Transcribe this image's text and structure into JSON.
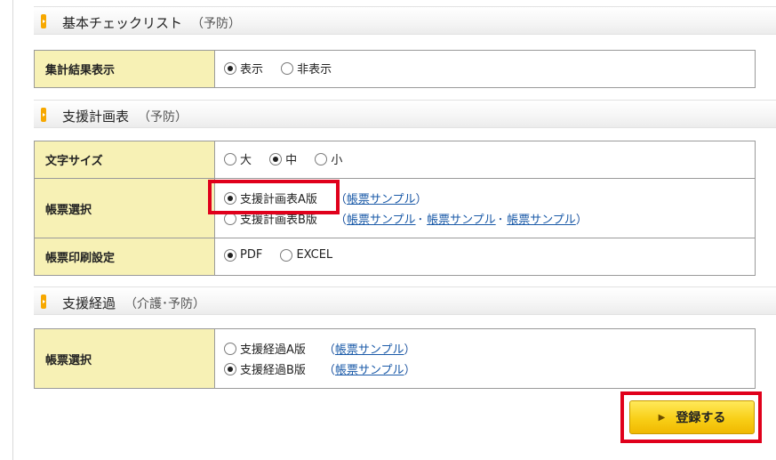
{
  "sections": [
    {
      "title": "基本チェックリスト",
      "sub": "（予防）"
    },
    {
      "title": "支援計画表",
      "sub": "（予防）"
    },
    {
      "title": "支援経過",
      "sub": "（介護･予防）"
    }
  ],
  "checklist": {
    "row_label": "集計結果表示",
    "options": [
      {
        "label": "表示",
        "selected": true
      },
      {
        "label": "非表示",
        "selected": false
      }
    ]
  },
  "plan": {
    "font_size": {
      "label": "文字サイズ",
      "options": [
        {
          "label": "大",
          "selected": false
        },
        {
          "label": "中",
          "selected": true
        },
        {
          "label": "小",
          "selected": false
        }
      ]
    },
    "form_select": {
      "label": "帳票選択",
      "options": [
        {
          "label": "支援計画表A版",
          "selected": true,
          "links": [
            "帳票サンプル"
          ]
        },
        {
          "label": "支援計画表B版",
          "selected": false,
          "links": [
            "帳票サンプル",
            "帳票サンプル",
            "帳票サンプル"
          ]
        }
      ]
    },
    "print_setting": {
      "label": "帳票印刷設定",
      "options": [
        {
          "label": "PDF",
          "selected": true
        },
        {
          "label": "EXCEL",
          "selected": false
        }
      ]
    }
  },
  "progress": {
    "form_select": {
      "label": "帳票選択",
      "options": [
        {
          "label": "支援経過A版",
          "selected": false,
          "links": [
            "帳票サンプル"
          ]
        },
        {
          "label": "支援経過B版",
          "selected": true,
          "links": [
            "帳票サンプル"
          ]
        }
      ]
    }
  },
  "paren_open": "（",
  "paren_close": "）",
  "link_sep": "･",
  "submit_label": "登録する",
  "colors": {
    "highlight": "#e0001b",
    "button": "#f8cf17",
    "header_cell": "#f7f1b5",
    "marker": "#f7a800"
  }
}
